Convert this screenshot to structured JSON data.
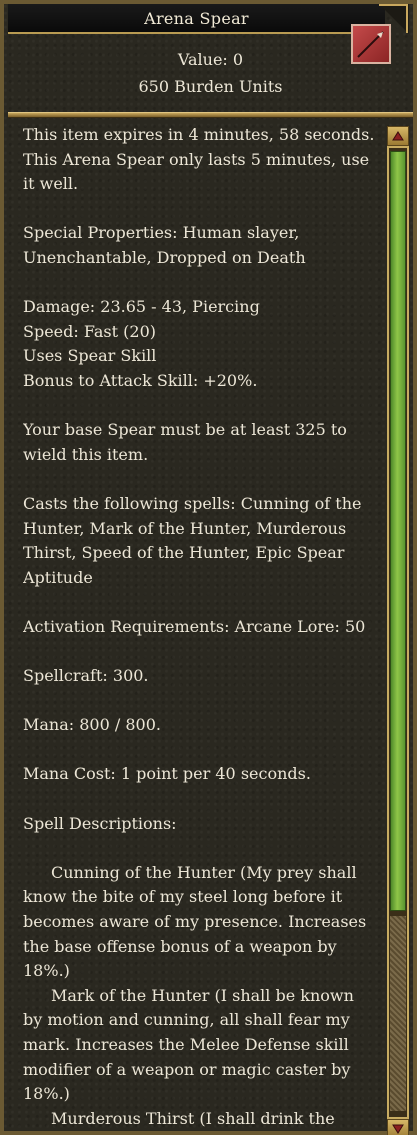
{
  "window": {
    "title": "Arena Spear"
  },
  "header": {
    "value": "Value: 0",
    "burden": "650 Burden Units"
  },
  "body": {
    "expires_line1": "This item expires in 4 minutes, 58 seconds.",
    "expires_line2": "This Arena Spear only lasts 5 minutes, use",
    "expires_line3": "it well.",
    "special_line1": "Special Properties: Human slayer,",
    "special_line2": "Unenchantable, Dropped on Death",
    "damage": "Damage: 23.65 - 43, Piercing",
    "speed": "Speed: Fast (20)",
    "skill": "Uses Spear Skill",
    "bonus": "Bonus to Attack Skill: +20%.",
    "wield_line1": "Your base Spear must be at least 325 to",
    "wield_line2": "wield this item.",
    "casts_line1": "Casts the following spells: Cunning of the",
    "casts_line2": "Hunter, Mark of the Hunter, Murderous",
    "casts_line3": "Thirst, Speed of the Hunter, Epic Spear",
    "casts_line4": "Aptitude",
    "activation": "Activation Requirements: Arcane Lore: 50",
    "spellcraft": "Spellcraft: 300.",
    "mana": "Mana: 800 / 800.",
    "mana_cost": "Mana Cost: 1 point per 40 seconds.",
    "spell_desc_header": "Spell Descriptions:",
    "desc1_line1": "Cunning of the Hunter (My prey shall",
    "desc1_line2": "know the bite of my steel long before it",
    "desc1_line3": "becomes aware of my presence. Increases",
    "desc1_line4": "the base offense bonus of a weapon by",
    "desc1_line5": "18%.)",
    "desc2_line1": "Mark of the Hunter (I shall be known",
    "desc2_line2": "by motion and cunning, all shall fear my",
    "desc2_line3": "mark. Increases the Melee Defense skill",
    "desc2_line4": "modifier of a weapon or magic caster by",
    "desc2_line5": "18%.)",
    "desc3_line1": "Murderous Thirst (I shall drink the"
  },
  "icons": {
    "item": "spear-icon",
    "scroll_up": "scroll-up-arrow-icon",
    "scroll_down": "scroll-down-arrow-icon"
  }
}
